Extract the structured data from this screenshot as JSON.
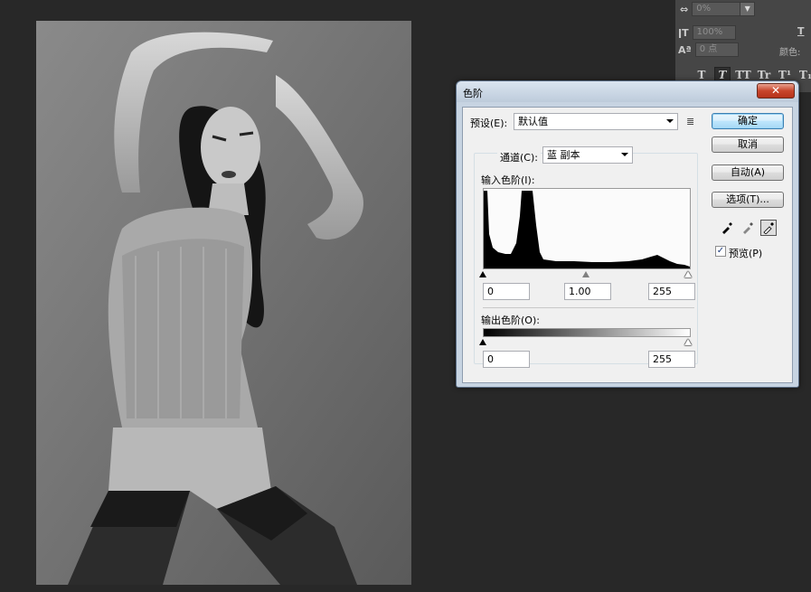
{
  "char_panel": {
    "tracking_value": "0%",
    "scale_value": "100%",
    "baseline_value": "0 点",
    "color_label": "颜色:",
    "typo_buttons": [
      "T",
      "T",
      "TT",
      "Tr",
      "T¹",
      "T₁"
    ]
  },
  "dialog": {
    "title": "色阶",
    "close_label": "✕",
    "preset_label": "预设(E):",
    "preset_value": "默认值",
    "channel_label": "通道(C):",
    "channel_value": "蓝 副本",
    "input_levels_label": "输入色阶(I):",
    "input_black": "0",
    "input_gamma": "1.00",
    "input_white": "255",
    "output_levels_label": "输出色阶(O):",
    "output_black": "0",
    "output_white": "255",
    "buttons": {
      "ok": "确定",
      "cancel": "取消",
      "auto": "自动(A)",
      "options": "选项(T)..."
    },
    "preview_label": "预览(P)",
    "preview_checked": "✓"
  },
  "colors": {
    "accent": "#3c7fb1",
    "close": "#c8452b",
    "background": "#282828"
  },
  "icons": [
    "black-eyedropper-icon",
    "gray-eyedropper-icon",
    "white-eyedropper-icon",
    "preset-menu-icon"
  ]
}
